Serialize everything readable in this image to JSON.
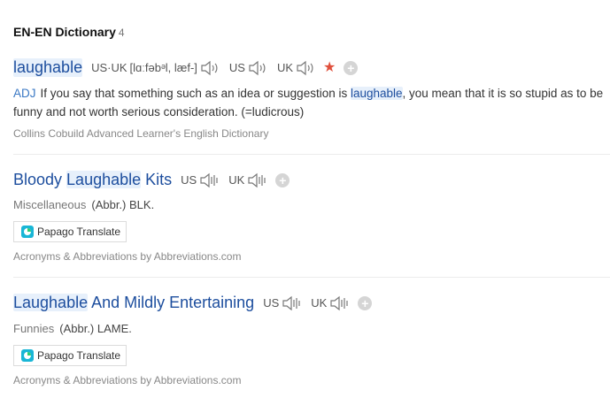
{
  "section": {
    "title": "EN-EN Dictionary",
    "count": "4"
  },
  "entry1": {
    "headword": "laughable",
    "region_label": "US·UK",
    "phonetic": "[lɑːfəbᵊl, læf-]",
    "us_label": "US",
    "uk_label": "UK",
    "pos": "ADJ",
    "def_before": "If you say that something such as an idea or suggestion is ",
    "def_highlight": "laughable",
    "def_after": ", you mean that it is so stupid as to be funny and not worth serious consideration. (=ludicrous)",
    "source": "Collins Cobuild Advanced Learner's English Dictionary"
  },
  "entry2": {
    "title_part1": "Bloody ",
    "title_highlight": "Laughable",
    "title_part2": " Kits",
    "us_label": "US",
    "uk_label": "UK",
    "category": "Miscellaneous",
    "meaning": "(Abbr.) BLK.",
    "translate_label": "Papago Translate",
    "source": "Acronyms & Abbreviations by Abbreviations.com"
  },
  "entry3": {
    "title_highlight": "Laughable",
    "title_part2": " And Mildly Entertaining",
    "us_label": "US",
    "uk_label": "UK",
    "category": "Funnies",
    "meaning": "(Abbr.) LAME.",
    "translate_label": "Papago Translate",
    "source": "Acronyms & Abbreviations by Abbreviations.com"
  },
  "icons": {
    "speaker": "speaker-icon",
    "star": "star-icon",
    "add": "plus-circle-icon",
    "papago": "papago-logo-icon"
  },
  "colors": {
    "headword": "#1d4e9e",
    "highlight": "#e7f0fb",
    "star": "#e0503c",
    "pos": "#3a78c4"
  }
}
